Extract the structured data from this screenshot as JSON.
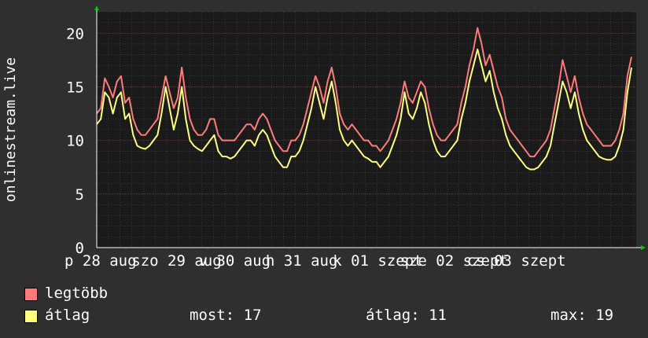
{
  "chart_data": {
    "type": "line",
    "ylabel": "onlinestream.live",
    "ylim": [
      0,
      22
    ],
    "y_ticks": [
      "0",
      "5",
      "10",
      "15",
      "20"
    ],
    "x_tick_labels": [
      "p 28 aug",
      "szo 29 aug",
      "v 30 aug",
      "h 31 aug",
      "k 01 szept",
      "sze 02 szept",
      "cs 03 szept"
    ],
    "grid": true,
    "series": [
      {
        "name": "legtöbb",
        "color": "#ff7b7b",
        "values": [
          12.5,
          13.0,
          15.8,
          15.0,
          14.0,
          15.5,
          16.0,
          13.5,
          14.0,
          12.0,
          11.0,
          10.5,
          10.5,
          11.0,
          11.5,
          12.0,
          14.0,
          16.0,
          14.5,
          13.0,
          14.0,
          16.8,
          14.0,
          12.0,
          11.0,
          10.5,
          10.5,
          11.0,
          12.0,
          12.0,
          10.5,
          10.0,
          10.0,
          10.0,
          10.0,
          10.5,
          11.0,
          11.5,
          11.5,
          11.0,
          12.0,
          12.5,
          12.0,
          11.0,
          10.0,
          9.5,
          9.0,
          9.0,
          10.0,
          10.0,
          10.5,
          11.5,
          13.0,
          14.5,
          16.0,
          15.0,
          13.5,
          15.5,
          16.8,
          15.0,
          12.5,
          11.5,
          11.0,
          11.5,
          11.0,
          10.5,
          10.0,
          10.0,
          9.5,
          9.5,
          9.0,
          9.5,
          10.0,
          11.0,
          12.0,
          13.5,
          15.5,
          14.0,
          13.5,
          14.5,
          15.5,
          15.0,
          13.0,
          11.5,
          10.5,
          10.0,
          10.0,
          10.5,
          11.0,
          11.5,
          13.5,
          15.0,
          17.0,
          18.5,
          20.5,
          19.0,
          17.0,
          18.0,
          16.5,
          15.0,
          14.0,
          12.0,
          11.0,
          10.5,
          10.0,
          9.5,
          9.0,
          8.5,
          8.5,
          9.0,
          9.5,
          10.0,
          11.0,
          13.0,
          15.0,
          17.5,
          16.0,
          14.5,
          16.0,
          14.0,
          12.5,
          11.5,
          11.0,
          10.5,
          10.0,
          9.5,
          9.5,
          9.5,
          10.0,
          11.0,
          12.5,
          16.0,
          17.8
        ]
      },
      {
        "name": "átlag",
        "color": "#ffff80",
        "values": [
          11.5,
          12.0,
          14.5,
          14.0,
          12.5,
          14.0,
          14.5,
          12.0,
          12.5,
          10.5,
          9.5,
          9.3,
          9.2,
          9.5,
          10.0,
          10.5,
          12.5,
          15.0,
          13.0,
          11.0,
          12.5,
          15.0,
          12.0,
          10.0,
          9.5,
          9.2,
          9.0,
          9.5,
          10.0,
          10.5,
          9.0,
          8.5,
          8.5,
          8.3,
          8.5,
          9.0,
          9.5,
          10.0,
          10.0,
          9.5,
          10.5,
          11.0,
          10.5,
          9.5,
          8.5,
          8.0,
          7.5,
          7.5,
          8.5,
          8.5,
          9.0,
          10.0,
          11.5,
          13.0,
          15.0,
          13.5,
          12.0,
          14.0,
          15.5,
          13.5,
          11.0,
          10.0,
          9.5,
          10.0,
          9.5,
          9.0,
          8.5,
          8.3,
          8.0,
          8.0,
          7.5,
          8.0,
          8.5,
          9.5,
          10.5,
          12.0,
          14.5,
          12.5,
          12.0,
          13.0,
          14.5,
          13.5,
          11.5,
          10.0,
          9.0,
          8.5,
          8.5,
          9.0,
          9.5,
          10.0,
          12.0,
          13.5,
          15.5,
          17.0,
          18.5,
          17.0,
          15.5,
          16.5,
          14.5,
          13.0,
          12.0,
          10.5,
          9.5,
          9.0,
          8.5,
          8.0,
          7.5,
          7.3,
          7.3,
          7.5,
          8.0,
          8.5,
          9.5,
          11.5,
          13.5,
          15.5,
          14.5,
          13.0,
          14.5,
          12.5,
          11.0,
          10.0,
          9.5,
          9.0,
          8.5,
          8.3,
          8.2,
          8.2,
          8.5,
          9.5,
          11.0,
          14.5,
          16.8
        ]
      }
    ]
  },
  "legend": {
    "items": [
      {
        "label": "legtöbb",
        "color": "#ff7b7b"
      },
      {
        "label": "átlag",
        "color": "#ffff80"
      }
    ],
    "stats": {
      "most": "most: 17",
      "atlag": "átlag: 11",
      "max": "max: 19"
    }
  }
}
